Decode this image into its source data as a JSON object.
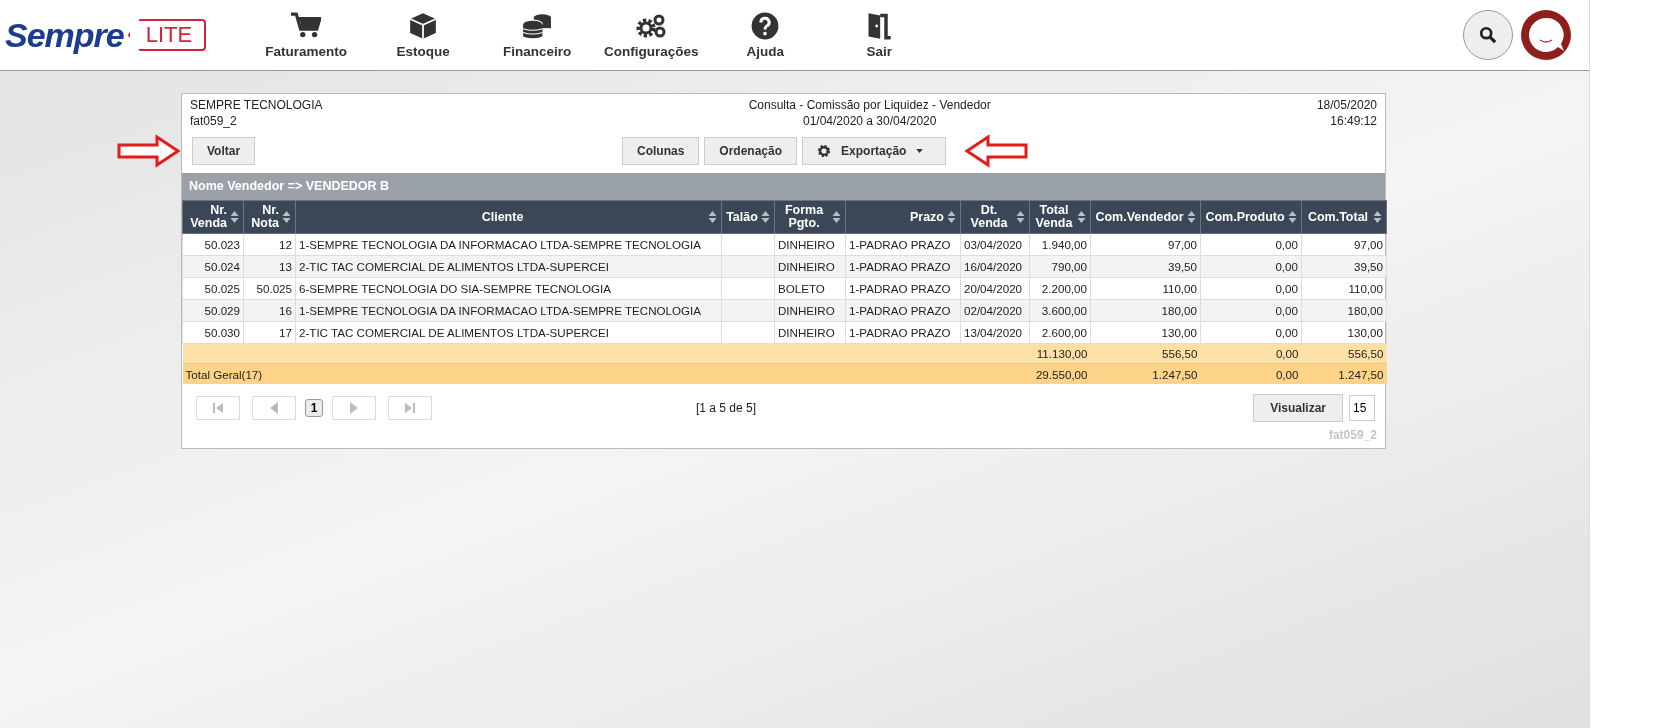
{
  "header": {
    "logo": {
      "brand": "Sempre",
      "tag": "LITE"
    },
    "nav": [
      {
        "label": "Faturamento"
      },
      {
        "label": "Estoque"
      },
      {
        "label": "Financeiro"
      },
      {
        "label": "Configurações"
      },
      {
        "label": "Ajuda"
      },
      {
        "label": "Sair"
      }
    ]
  },
  "report": {
    "company": "SEMPRE TECNOLOGIA",
    "code": "fat059_2",
    "title": "Consulta - Comissão por Liquidez - Vendedor",
    "period": "01/04/2020 a 30/04/2020",
    "date": "18/05/2020",
    "time": "16:49:12",
    "toolbar": {
      "back": "Voltar",
      "buttons": [
        "Colunas",
        "Ordenação"
      ],
      "export": "Exportação"
    },
    "group": "Nome Vendedor => VENDEDOR B",
    "table": {
      "columns": [
        {
          "label": "Nr. Venda"
        },
        {
          "label": "Nr. Nota"
        },
        {
          "label": "Cliente"
        },
        {
          "label": "Talão"
        },
        {
          "label": "Forma Pgto."
        },
        {
          "label": "Prazo"
        },
        {
          "label": "Dt. Venda"
        },
        {
          "label": "Total Venda"
        },
        {
          "label": "Com.Vendedor"
        },
        {
          "label": "Com.Produto"
        },
        {
          "label": "Com.Total"
        }
      ],
      "rows": [
        [
          "50.023",
          "12",
          "1-SEMPRE TECNOLOGIA DA INFORMACAO LTDA-SEMPRE TECNOLOGIA",
          "",
          "DINHEIRO",
          "1-PADRAO PRAZO",
          "03/04/2020",
          "1.940,00",
          "97,00",
          "0,00",
          "97,00"
        ],
        [
          "50.024",
          "13",
          "2-TIC TAC COMERCIAL DE ALIMENTOS LTDA-SUPERCEI",
          "",
          "DINHEIRO",
          "1-PADRAO PRAZO",
          "16/04/2020",
          "790,00",
          "39,50",
          "0,00",
          "39,50"
        ],
        [
          "50.025",
          "50.025",
          "6-SEMPRE TECNOLOGIA DO SIA-SEMPRE TECNOLOGIA",
          "",
          "BOLETO",
          "1-PADRAO PRAZO",
          "20/04/2020",
          "2.200,00",
          "110,00",
          "0,00",
          "110,00"
        ],
        [
          "50.029",
          "16",
          "1-SEMPRE TECNOLOGIA DA INFORMACAO LTDA-SEMPRE TECNOLOGIA",
          "",
          "DINHEIRO",
          "1-PADRAO PRAZO",
          "02/04/2020",
          "3.600,00",
          "180,00",
          "0,00",
          "180,00"
        ],
        [
          "50.030",
          "17",
          "2-TIC TAC COMERCIAL DE ALIMENTOS LTDA-SUPERCEI",
          "",
          "DINHEIRO",
          "1-PADRAO PRAZO",
          "13/04/2020",
          "2.600,00",
          "130,00",
          "0,00",
          "130,00"
        ]
      ],
      "subtotal": [
        "11.130,00",
        "556,50",
        "0,00",
        "556,50"
      ],
      "total": {
        "label": "Total Geral(17)",
        "values": [
          "29.550,00",
          "1.247,50",
          "0,00",
          "1.247,50"
        ]
      }
    },
    "pagination": {
      "first_disabled": true,
      "prev_disabled": true,
      "next_disabled": true,
      "last_disabled": true,
      "pages": [
        {
          "label": "1",
          "selected": true
        }
      ],
      "range": "[1 a 5 de 5]",
      "view": "Visualizar",
      "page_size": "15"
    },
    "footer_code": "fat059_2"
  }
}
